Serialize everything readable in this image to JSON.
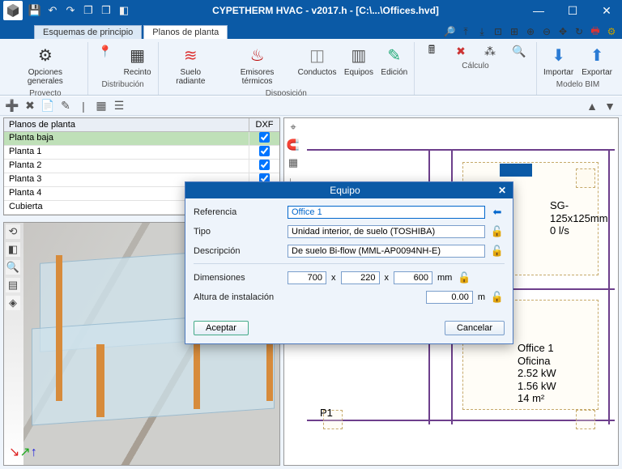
{
  "title": "CYPETHERM HVAC - v2017.h - [C:\\...\\Offices.hvd]",
  "tabs": {
    "schemes": "Esquemas de principio",
    "floors": "Planos de planta"
  },
  "ribbon": {
    "project": "Proyecto",
    "distribution": "Distribución",
    "arrangement": "Disposición",
    "calc": "Cálculo",
    "bim": "Modelo BIM",
    "general": "Opciones\ngenerales",
    "enclosure": "Recinto",
    "radiant": "Suelo\nradiante",
    "emitters": "Emisores\ntérmicos",
    "ducts": "Conductos",
    "equip": "Equipos",
    "edit": "Edición",
    "import": "Importar",
    "export": "Exportar"
  },
  "list": {
    "header": "Planos de planta",
    "dxf": "DXF",
    "rows": [
      "Planta baja",
      "Planta 1",
      "Planta 2",
      "Planta 3",
      "Planta 4",
      "Cubierta"
    ]
  },
  "dialog": {
    "title": "Equipo",
    "ref_lbl": "Referencia",
    "ref_val": "Office 1",
    "type_lbl": "Tipo",
    "type_val": "Unidad interior, de suelo (TOSHIBA)",
    "desc_lbl": "Descripción",
    "desc_val": "De suelo Bi-flow (MML-AP0094NH-E)",
    "dim_lbl": "Dimensiones",
    "dim_w": "700",
    "dim_d": "220",
    "dim_h": "600",
    "dim_unit": "mm",
    "height_lbl": "Altura de instalación",
    "height_val": "0.00",
    "height_unit": "m",
    "ok": "Aceptar",
    "cancel": "Cancelar"
  },
  "plan": {
    "grille": "SG-125x125mm",
    "flow": "0 l/s",
    "p1": "P1",
    "room_name": "Office 1",
    "room_type": "Oficina",
    "cooling": "2.52 kW",
    "heating": "1.56 kW",
    "area": "14 m²"
  }
}
